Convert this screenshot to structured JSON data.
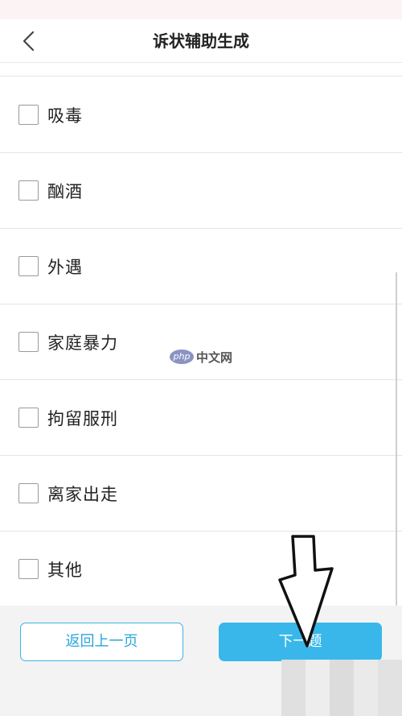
{
  "header": {
    "title": "诉状辅助生成",
    "back_icon": "chevron-left-icon"
  },
  "options": [
    {
      "label": "吸毒",
      "checked": false
    },
    {
      "label": "酗酒",
      "checked": false
    },
    {
      "label": "外遇",
      "checked": false
    },
    {
      "label": "家庭暴力",
      "checked": false
    },
    {
      "label": "拘留服刑",
      "checked": false
    },
    {
      "label": "离家出走",
      "checked": false
    },
    {
      "label": "其他",
      "checked": false
    }
  ],
  "footer": {
    "prev_label": "返回上一页",
    "next_label": "下一题"
  },
  "watermark": {
    "logo_text": "php",
    "text": "中文网"
  },
  "colors": {
    "accent": "#39b7ea",
    "status_bar": "#fcf3f5",
    "footer_bg": "#f3f3f3"
  }
}
